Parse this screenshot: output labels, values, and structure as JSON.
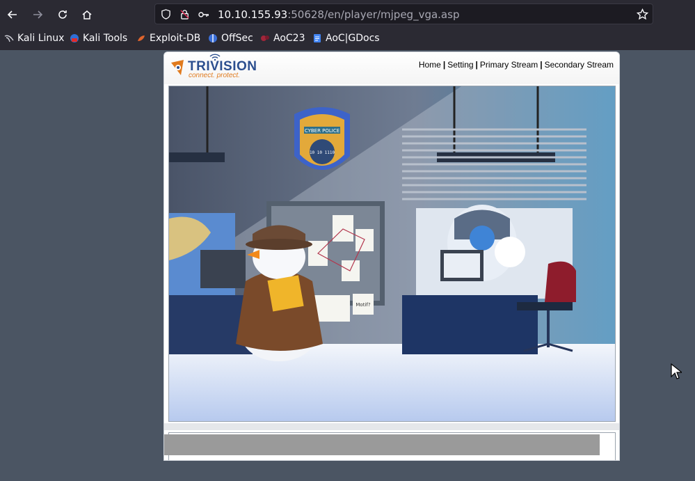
{
  "browser": {
    "url_host": "10.10.155.93",
    "url_rest": ":50628/en/player/mjpeg_vga.asp",
    "bookmarks": [
      {
        "label": "Kali Linux",
        "icon": "kali-dragon-icon"
      },
      {
        "label": "Kali Tools",
        "icon": "kali-tools-icon"
      },
      {
        "label": "Exploit-DB",
        "icon": "exploit-db-icon"
      },
      {
        "label": "OffSec",
        "icon": "offsec-icon"
      },
      {
        "label": "AoC23",
        "icon": "aoc-icon"
      },
      {
        "label": "AoC|GDocs",
        "icon": "gdocs-icon"
      }
    ]
  },
  "camera_page": {
    "brand": "TRIVISION",
    "tagline": "connect. protect.",
    "nav": [
      {
        "label": "Home"
      },
      {
        "label": "Setting"
      },
      {
        "label": "Primary Stream"
      },
      {
        "label": "Secondary Stream"
      }
    ],
    "badge_text": "CYBER POLICE",
    "badge_code": "10 10 1110",
    "note_text": "Motif?"
  },
  "colors": {
    "brand_blue": "#2c4f8f",
    "brand_orange": "#e07b1f",
    "browser_bg": "#2b2a33",
    "page_bg": "#4b5563"
  }
}
